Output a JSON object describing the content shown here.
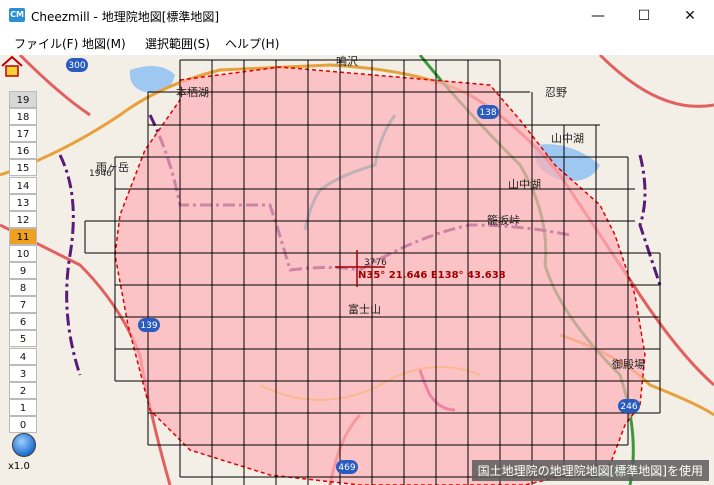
{
  "window": {
    "title": "Cheezmill - 地理院地図[標準地図]",
    "icon_name": "app-icon",
    "minimize_label": "—",
    "maximize_label": "☐",
    "close_label": "✕"
  },
  "menu": [
    {
      "label": "ファイル(F)"
    },
    {
      "label": "地図(M)"
    },
    {
      "label": "選択範囲(S)"
    },
    {
      "label": "ヘルプ(H)"
    }
  ],
  "zoom": {
    "levels": [
      "19",
      "18",
      "17",
      "16",
      "15",
      "14",
      "13",
      "12",
      "11",
      "10",
      "9",
      "8",
      "7",
      "6",
      "5",
      "4",
      "3",
      "2",
      "1",
      "0"
    ],
    "current": "11",
    "scale": "x1.0"
  },
  "map": {
    "labels": {
      "narusawa": "鳴沢",
      "oshino": "忍野",
      "yamanakako_lake": "山中湖",
      "yamanakako_town": "山中湖",
      "amagatake": "雨ヶ岳",
      "amagatake_elev": "1946",
      "kagosaka": "籠坂峠",
      "fujisan": "富士山",
      "summit_elev": "3776",
      "gotemba": "御殿場",
      "motosu": "本栖湖",
      "route_300": "300",
      "route_138": "138",
      "route_139": "139",
      "route_469": "469",
      "route_246": "246"
    },
    "coordinate": "N35° 21.646 E138° 43.638",
    "credit": "国土地理院の地理院地図[標準地図]を使用"
  },
  "colors": {
    "selection_fill": "#ffb0b8",
    "selection_border": "#e00000",
    "grid": "#000000",
    "zoom_active": "#f0a020"
  }
}
